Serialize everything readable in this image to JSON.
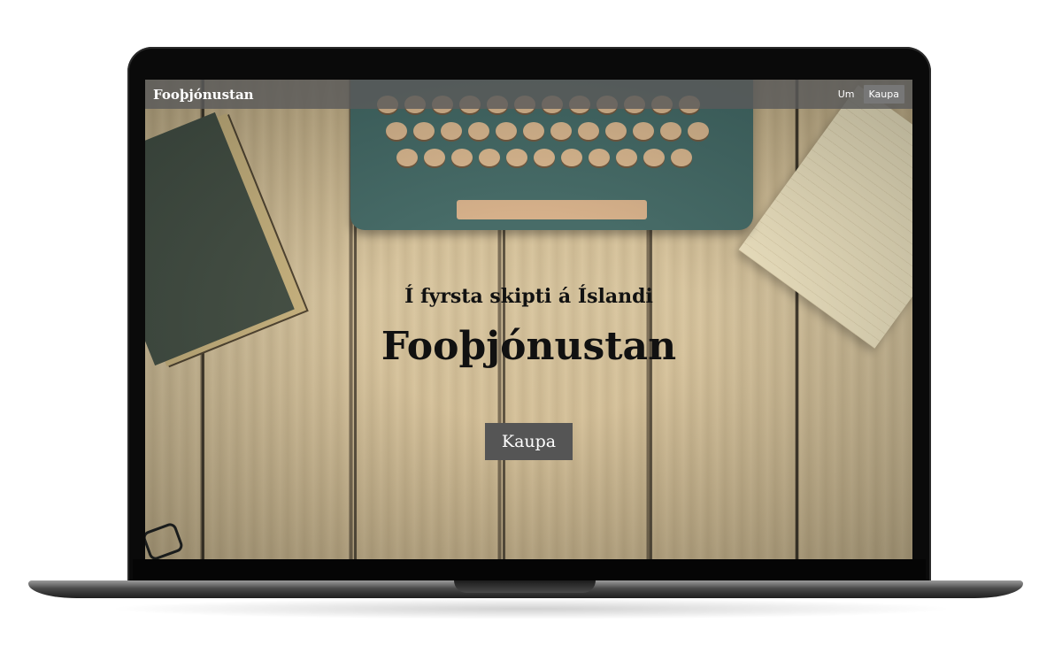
{
  "navbar": {
    "brand": "Fooþjónustan",
    "links": [
      {
        "label": "Um",
        "active": false
      },
      {
        "label": "Kaupa",
        "active": true
      }
    ]
  },
  "hero": {
    "tagline": "Í fyrsta skipti á Íslandi",
    "title": "Fooþjónustan",
    "cta_label": "Kaupa"
  },
  "colors": {
    "navbar_bg": "#5a5a5a",
    "active_link_bg": "#777777",
    "cta_bg": "#555555",
    "hero_text": "#111111"
  }
}
